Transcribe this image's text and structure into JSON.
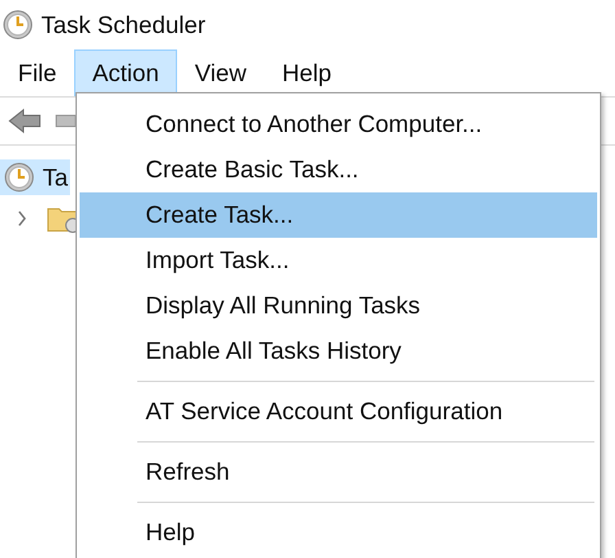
{
  "window": {
    "title": "Task Scheduler"
  },
  "menu_bar": [
    {
      "label": "File",
      "selected": false
    },
    {
      "label": "Action",
      "selected": true
    },
    {
      "label": "View",
      "selected": false
    },
    {
      "label": "Help",
      "selected": false
    }
  ],
  "tree": [
    {
      "label": "Ta",
      "selected": true,
      "children": [
        {
          "selected": false,
          "expanded": false
        }
      ]
    }
  ],
  "action_menu": [
    {
      "kind": "item",
      "label": "Connect to Another Computer...",
      "selected": false
    },
    {
      "kind": "item",
      "label": "Create Basic Task...",
      "selected": false
    },
    {
      "kind": "item",
      "label": "Create Task...",
      "selected": true
    },
    {
      "kind": "item",
      "label": "Import Task...",
      "selected": false
    },
    {
      "kind": "item",
      "label": "Display All Running Tasks",
      "selected": false
    },
    {
      "kind": "item",
      "label": "Enable All Tasks History",
      "selected": false
    },
    {
      "kind": "separator"
    },
    {
      "kind": "item",
      "label": "AT Service Account Configuration",
      "selected": false
    },
    {
      "kind": "separator"
    },
    {
      "kind": "item",
      "label": "Refresh",
      "selected": false
    },
    {
      "kind": "separator"
    },
    {
      "kind": "item",
      "label": "Help",
      "selected": false
    }
  ]
}
